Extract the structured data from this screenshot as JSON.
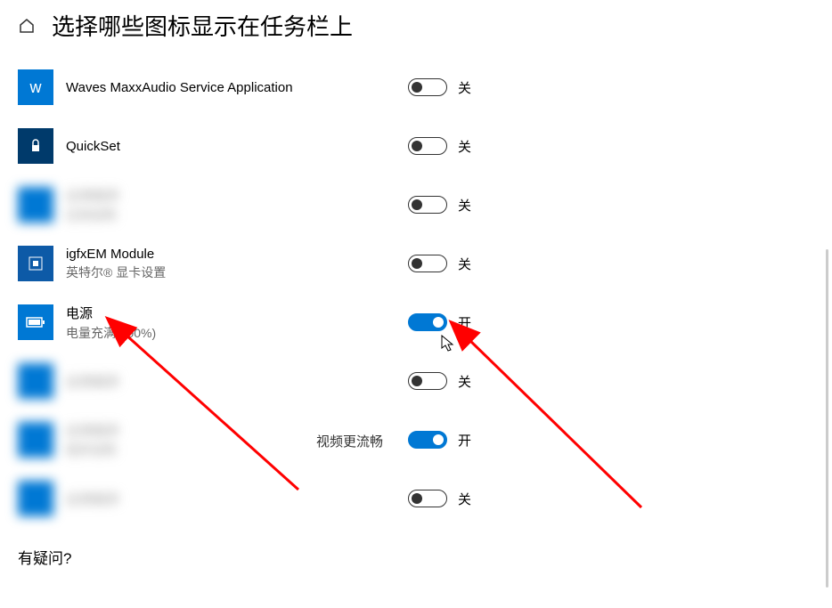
{
  "header": {
    "title": "选择哪些图标显示在任务栏上"
  },
  "items": [
    {
      "label": "Waves MaxxAudio Service Application",
      "sublabel": "",
      "icon": "waves",
      "iconClass": "blue",
      "state": "off",
      "stateLabel": "关",
      "blurred": false
    },
    {
      "label": "QuickSet",
      "sublabel": "",
      "icon": "lock",
      "iconClass": "dark-blue",
      "state": "off",
      "stateLabel": "关",
      "blurred": false
    },
    {
      "label": "应用程序",
      "sublabel": "应用说明",
      "icon": "generic",
      "iconClass": "blue blurred",
      "state": "off",
      "stateLabel": "关",
      "blurred": true
    },
    {
      "label": "igfxEM Module",
      "sublabel": "英特尔® 显卡设置",
      "icon": "intel",
      "iconClass": "deep-blue",
      "state": "off",
      "stateLabel": "关",
      "blurred": false
    },
    {
      "label": "电源",
      "sublabel": "电量充满(100%)",
      "icon": "battery",
      "iconClass": "blue",
      "state": "on",
      "stateLabel": "开",
      "blurred": false
    },
    {
      "label": "应用程序",
      "sublabel": "",
      "icon": "generic",
      "iconClass": "blue blurred",
      "state": "off",
      "stateLabel": "关",
      "blurred": true
    },
    {
      "label": "应用程序",
      "sublabel": "程序说明",
      "icon": "generic",
      "iconClass": "blue blurred",
      "state": "on",
      "stateLabel": "开",
      "blurred": true
    },
    {
      "label": "应用程序",
      "sublabel": "",
      "icon": "generic",
      "iconClass": "blue blurred",
      "state": "off",
      "stateLabel": "关",
      "blurred": true
    }
  ],
  "overlay": {
    "video_text": "视频更流畅"
  },
  "footer": {
    "question": "有疑问?"
  },
  "colors": {
    "accent": "#0078d4",
    "arrow": "#ff0000"
  }
}
